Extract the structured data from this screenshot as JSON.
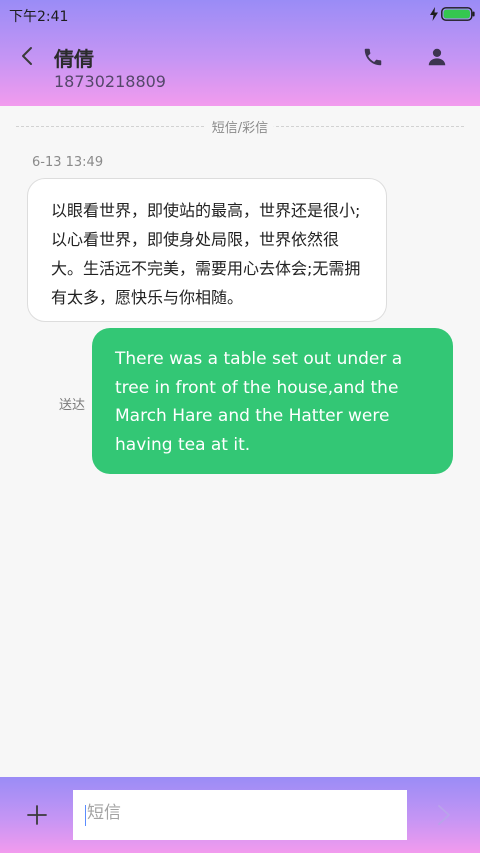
{
  "status": {
    "time": "下午2:41"
  },
  "header": {
    "name": "倩倩",
    "number": "18730218809"
  },
  "separator_label": "短信/彩信",
  "thread": {
    "timestamp": "6-13 13:49",
    "incoming_text": "以眼看世界，即使站的最高，世界还是很小;以心看世界，即使身处局限，世界依然很大。生活远不完美，需要用心去体会;无需拥有太多，愿快乐与你相随。",
    "outgoing_text": "There was a table set out under a tree in front of the house,and the March Hare and the Hatter were having tea at it.",
    "outgoing_status": "送达"
  },
  "composer": {
    "placeholder": "短信"
  },
  "colors": {
    "bubble_out": "#33c775",
    "gradient_top": "#9a8cf6",
    "gradient_bottom": "#f29bee",
    "battery": "#35c750"
  },
  "icons": [
    "back-arrow-icon",
    "phone-icon",
    "contact-icon",
    "charging-icon",
    "battery-icon",
    "add-icon",
    "send-icon"
  ]
}
